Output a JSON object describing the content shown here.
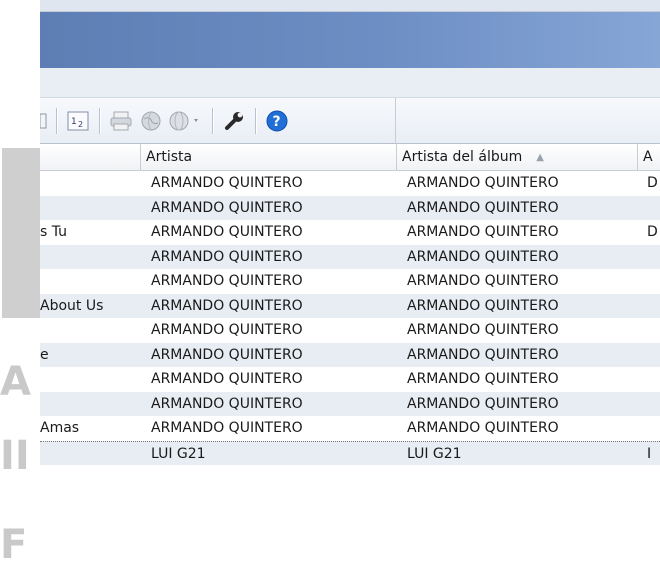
{
  "toolbar": {
    "icons": [
      "partial-icon",
      "numbered-list-icon",
      "print-icon",
      "globe-icon",
      "globe-dropdown-icon",
      "wrench-icon",
      "help-icon"
    ]
  },
  "table": {
    "columns": [
      "",
      "Artista",
      "Artista del álbum",
      "A"
    ],
    "rows": [
      {
        "title": "",
        "artist": "ARMANDO QUINTERO",
        "album_artist": "ARMANDO QUINTERO",
        "extra": "D"
      },
      {
        "title": "",
        "artist": "ARMANDO QUINTERO",
        "album_artist": "ARMANDO QUINTERO",
        "extra": ""
      },
      {
        "title": "s Tu",
        "artist": "ARMANDO QUINTERO",
        "album_artist": "ARMANDO QUINTERO",
        "extra": "D"
      },
      {
        "title": "",
        "artist": "ARMANDO QUINTERO",
        "album_artist": "ARMANDO QUINTERO",
        "extra": ""
      },
      {
        "title": "",
        "artist": "ARMANDO QUINTERO",
        "album_artist": "ARMANDO QUINTERO",
        "extra": ""
      },
      {
        "title": "About Us",
        "artist": "ARMANDO QUINTERO",
        "album_artist": "ARMANDO QUINTERO",
        "extra": ""
      },
      {
        "title": "",
        "artist": "ARMANDO QUINTERO",
        "album_artist": "ARMANDO QUINTERO",
        "extra": ""
      },
      {
        "title": "e",
        "artist": "ARMANDO QUINTERO",
        "album_artist": "ARMANDO QUINTERO",
        "extra": ""
      },
      {
        "title": "",
        "artist": "ARMANDO QUINTERO",
        "album_artist": "ARMANDO QUINTERO",
        "extra": ""
      },
      {
        "title": "",
        "artist": "ARMANDO QUINTERO",
        "album_artist": "ARMANDO QUINTERO",
        "extra": ""
      },
      {
        "title": "Amas",
        "artist": "ARMANDO QUINTERO",
        "album_artist": "ARMANDO QUINTERO",
        "extra": ""
      },
      {
        "title": "",
        "artist": "LUI G21",
        "album_artist": "LUI G21",
        "extra": "I"
      }
    ]
  },
  "watermark": {
    "letters": [
      "A",
      "II",
      "F"
    ]
  },
  "colors": {
    "titlebar": "#6d8ec4",
    "row_alt": "#e8edf3",
    "help": "#1f6fd6"
  }
}
